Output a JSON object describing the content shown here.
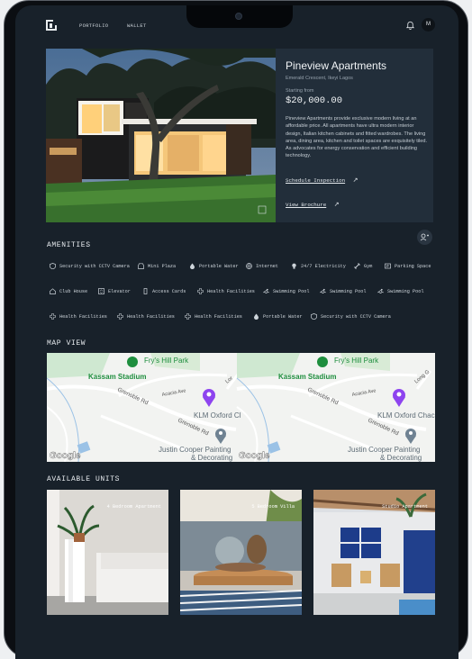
{
  "nav": {
    "items": [
      "PORTFOLIO",
      "WALLET"
    ],
    "avatar_initial": "M"
  },
  "property": {
    "title": "Pineview Apartments",
    "address": "Emerald Crescent, Ikeyi Lagos",
    "price_label": "Starting from",
    "price": "$20,000.00",
    "description": "Pineview Apartments provide exclusive modern living at an affordable price. All apartments have ultra modern interior design, Italian kitchen cabinets and fitted wardrobes. The living area, dining area, kitchen and toilet spaces are exquisitely tiled. As advocates for energy conservation and efficient building technology.",
    "schedule_link": "Schedule Inspection",
    "brochure_link": "View Brochure"
  },
  "amenities": {
    "title": "AMENITIES",
    "rows": [
      [
        {
          "label": "Security with CCTV Camera",
          "icon": "shield-icon"
        },
        {
          "label": "Mini Plaza",
          "icon": "store-icon"
        },
        {
          "label": "Portable Water",
          "icon": "drop-icon"
        },
        {
          "label": "Internet",
          "icon": "globe-icon"
        },
        {
          "label": "24/7 Electricity",
          "icon": "bulb-icon"
        },
        {
          "label": "Gym",
          "icon": "dumbbell-icon"
        },
        {
          "label": "Parking Space",
          "icon": "parking-icon"
        }
      ],
      [
        {
          "label": "Club House",
          "icon": "house-icon"
        },
        {
          "label": "Elevator",
          "icon": "elevator-icon"
        },
        {
          "label": "Access Cards",
          "icon": "card-icon"
        },
        {
          "label": "Health Facilities",
          "icon": "health-icon"
        },
        {
          "label": "Swimming Pool",
          "icon": "swim-icon"
        },
        {
          "label": "Swimming Pool",
          "icon": "swim-icon"
        },
        {
          "label": "Swimming Pool",
          "icon": "swim-icon"
        }
      ],
      [
        {
          "label": "Health Facilities",
          "icon": "health-icon"
        },
        {
          "label": "Health Facilities",
          "icon": "health-icon"
        },
        {
          "label": "Health Facilities",
          "icon": "health-icon"
        },
        {
          "label": "Portable Water",
          "icon": "drop-icon"
        },
        {
          "label": "Security with CCTV Camera",
          "icon": "shield-icon"
        }
      ]
    ]
  },
  "map": {
    "title": "MAP VIEW",
    "labels": {
      "park": "Fry's Hill Park",
      "stadium": "Kassam Stadium",
      "road1": "Grenoble Rd",
      "road2": "Acacia Ave",
      "road3": "Grenoble Rd",
      "klm_left": "KLM Oxford Cl",
      "klm_right": "KLM Oxford Chac",
      "painting": "Justin Cooper Painting",
      "painting2": "& Decorating",
      "long": "Lor",
      "long_right": "Long G",
      "google": "Google"
    }
  },
  "units": {
    "title": "AVAILABLE UNITS",
    "items": [
      {
        "label": "4 Bedroom Apartment"
      },
      {
        "label": "5 Bedroom Villa"
      },
      {
        "label": "Studio Apartment"
      }
    ]
  }
}
